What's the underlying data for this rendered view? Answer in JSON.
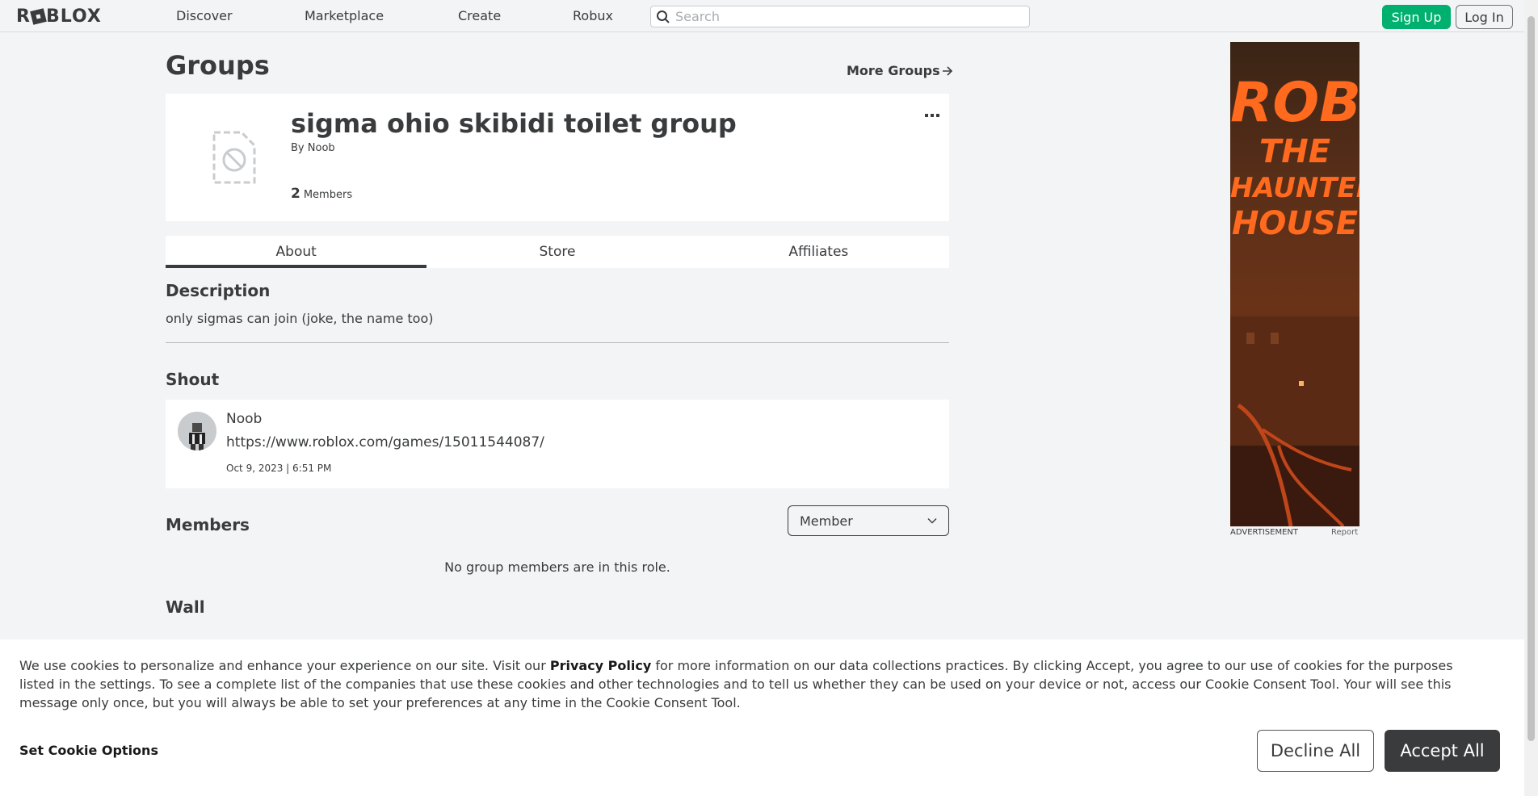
{
  "nav": {
    "logo": "ROBLOX",
    "links": [
      "Discover",
      "Marketplace",
      "Create",
      "Robux"
    ],
    "search_placeholder": "Search",
    "signup_label": "Sign Up",
    "login_label": "Log In"
  },
  "header": {
    "title": "Groups",
    "more_groups": "More Groups"
  },
  "group": {
    "name": "sigma ohio skibidi toilet group",
    "by_prefix": "By",
    "owner": "Noob",
    "member_count": "2",
    "members_label": "Members"
  },
  "tabs": [
    "About",
    "Store",
    "Affiliates"
  ],
  "description": {
    "heading": "Description",
    "text": "only sigmas can join (joke, the name too)"
  },
  "shout": {
    "heading": "Shout",
    "user": "Noob",
    "body": "https://www.roblox.com/games/15011544087/",
    "date": "Oct 9, 2023 | 6:51 PM"
  },
  "members": {
    "heading": "Members",
    "role_selected": "Member",
    "empty_text": "No group members are in this role."
  },
  "wall": {
    "heading": "Wall"
  },
  "ad": {
    "line1": "ROB",
    "line2": "THE",
    "line3": "HAUNTED",
    "line4": "HOUSE",
    "label": "ADVERTISEMENT",
    "report": "Report"
  },
  "cookie": {
    "text_before": "We use cookies to personalize and enhance your experience on our site. Visit our ",
    "privacy_link": "Privacy Policy",
    "text_after": " for more information on our data collections practices. By clicking Accept, you agree to our use of cookies for the purposes listed in the settings. To see a complete list of the companies that use these cookies and other technologies and to tell us whether they can be used on your device or not, access our Cookie Consent Tool. Your will see this message only once, but you will always be able to set your preferences at any time in the Cookie Consent Tool.",
    "set_options": "Set Cookie Options",
    "decline": "Decline All",
    "accept": "Accept All"
  },
  "colors": {
    "accent_green": "#00b06f",
    "text_dark": "#393b3d",
    "page_bg": "#f2f4f5",
    "ad_orange": "#ff6a1f"
  }
}
